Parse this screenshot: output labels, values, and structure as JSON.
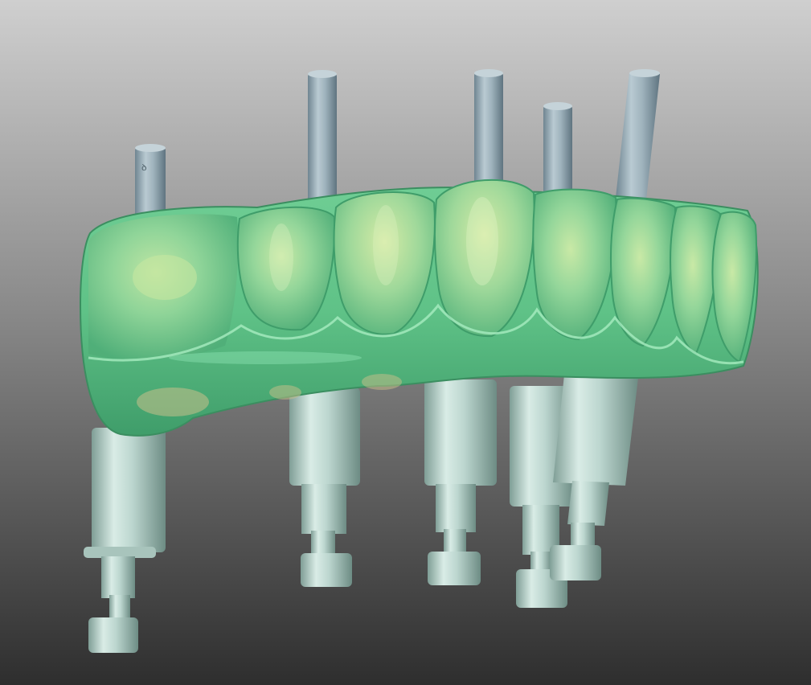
{
  "viewport": {
    "background_top": "#cfcfcf",
    "background_bottom": "#2e2e2e"
  },
  "model": {
    "crown_color": "#74d39a",
    "crown_highlight": "#b8f0c8",
    "crown_shadow": "#3f9d6a",
    "gingiva_tint": "#c9c08a",
    "scan_body_color": "#9fb3bd",
    "scan_body_shadow": "#6f8591",
    "analog_color": "#bcd6cf",
    "analog_shadow": "#7f9e96"
  },
  "icons": {
    "scene": "3d-viewport",
    "object": "implant-bridge-model"
  }
}
